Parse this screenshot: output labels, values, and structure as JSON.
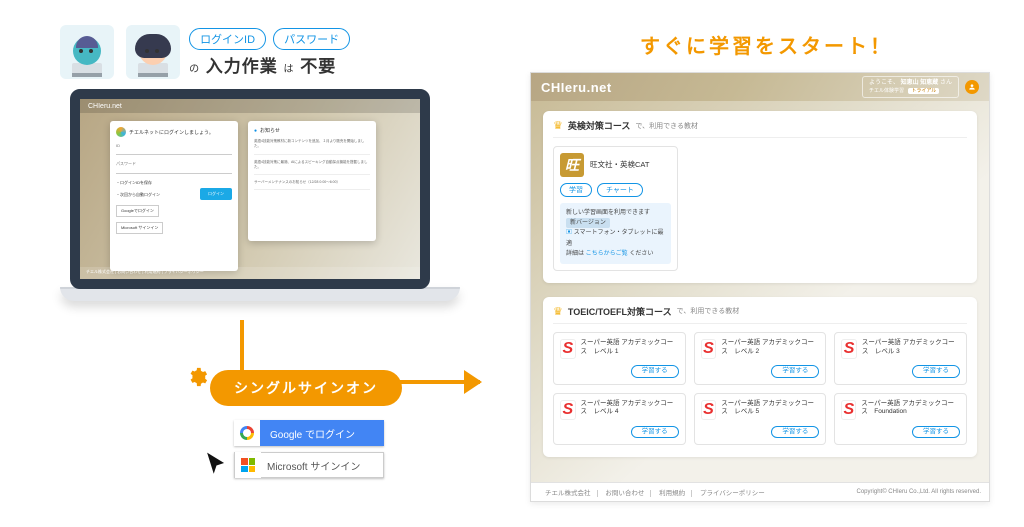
{
  "left": {
    "badge_login_id": "ログインID",
    "badge_password": "パスワード",
    "entry_prefix": "の",
    "entry_main": "入力作業",
    "entry_mid": "は",
    "entry_strong": "不要"
  },
  "login_screen": {
    "brand": "CHIeru.net",
    "welcome": "チエルネットにログインしましょう。",
    "field_username": "ID",
    "field_password": "パスワード",
    "keep1": "・ログインIDを保存",
    "keep2": "・次回から自動ログイン",
    "login_btn": "ログイン",
    "google_btn": "Googleでログイン",
    "ms_btn": "Microsoft サインイン",
    "news_heading": "お知らせ",
    "news_items": [
      "英語4技能対策教材に新コンテンツを追加、１月より販売を開始しました。",
      "英語4技能対策に最適、AIによるスピーキング自動採点機能を搭載しました。",
      "サーバーメンテナンスのお知らせ（12/28 0:00〜6:00）"
    ],
    "footer": "チエル株式会社 | お問い合わせ | 利用規約 | プライバシーポリシー"
  },
  "sso": {
    "label": "シングルサインオン",
    "google": "Google でログイン",
    "microsoft": "Microsoft サインイン"
  },
  "right": {
    "headline": "すぐに学習をスタート！"
  },
  "app": {
    "brand": "CHIeru.net",
    "greeting_prefix": "ようこそ、",
    "user_name": "知恵山 知恵蔵",
    "greeting_suffix": " さん",
    "trial_label": "チエル体験学習",
    "trial_badge": "トライアル",
    "sections": [
      {
        "title": "英検対策コース",
        "subtitle": "で、利用できる教材"
      },
      {
        "title": "TOEIC/TOEFL対策コース",
        "subtitle": "で、利用できる教材"
      }
    ],
    "eiken_course": {
      "name": "旺文社・英検CAT",
      "study": "学習",
      "chart": "チャート",
      "notice_line1": "新しい学習画面を利用できます",
      "notice_btn": "新バージョン",
      "notice_line2": "スマートフォン・タブレットに最適",
      "notice_line3_pre": "詳細は ",
      "notice_link": "こちらからご覧",
      "notice_line3_post": " ください"
    },
    "toeic_courses": [
      "スーパー英語 アカデミックコース　レベル 1",
      "スーパー英語 アカデミックコース　レベル 2",
      "スーパー英語 アカデミックコース　レベル 3",
      "スーパー英語 アカデミックコース　レベル 4",
      "スーパー英語 アカデミックコース　レベル 5",
      "スーパー英語 アカデミックコース　Foundation"
    ],
    "study_label": "学習する",
    "footer_links": [
      "チエル株式会社",
      "お問い合わせ",
      "利用規約",
      "プライバシーポリシー"
    ],
    "copyright": "Copyright© CHIeru Co.,Ltd. All rights reserved."
  }
}
